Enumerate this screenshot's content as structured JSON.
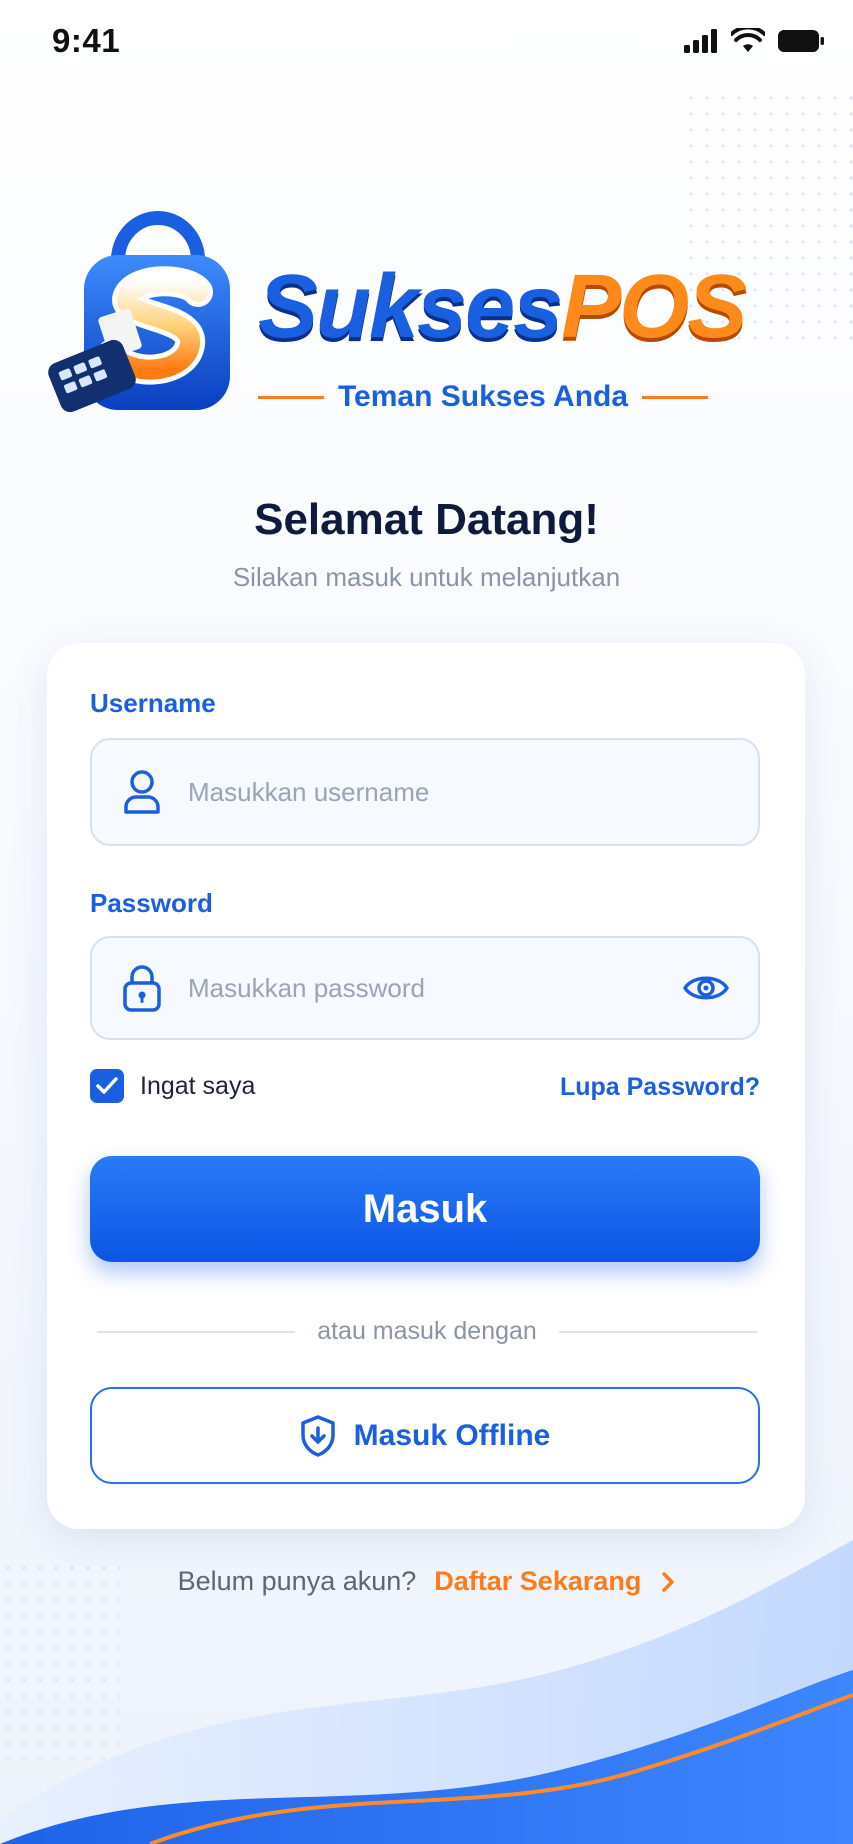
{
  "status_bar": {
    "time": "9:41"
  },
  "brand": {
    "name_part1": "Sukses",
    "name_part2": "POS",
    "tagline": "Teman Sukses Anda"
  },
  "welcome": {
    "title": "Selamat Datang!",
    "subtitle": "Silakan masuk untuk melanjutkan"
  },
  "form": {
    "username_label": "Username",
    "username_placeholder": "Masukkan username",
    "password_label": "Password",
    "password_placeholder": "Masukkan password",
    "remember_label": "Ingat saya",
    "remember_checked": true,
    "forgot_label": "Lupa Password?",
    "submit_label": "Masuk",
    "divider_text": "atau masuk dengan",
    "offline_label": "Masuk Offline"
  },
  "footer": {
    "question": "Belum punya akun?",
    "register_label": "Daftar Sekarang"
  },
  "icons": {
    "user": "user-icon",
    "lock": "lock-icon",
    "eye": "eye-icon",
    "check": "check-icon",
    "shield": "shield-icon",
    "chevron": "chevron-right-icon"
  },
  "colors": {
    "primary": "#1a5fe0",
    "accent": "#ff7a1a",
    "text": "#0f1b3d",
    "muted": "#8b94a7"
  }
}
